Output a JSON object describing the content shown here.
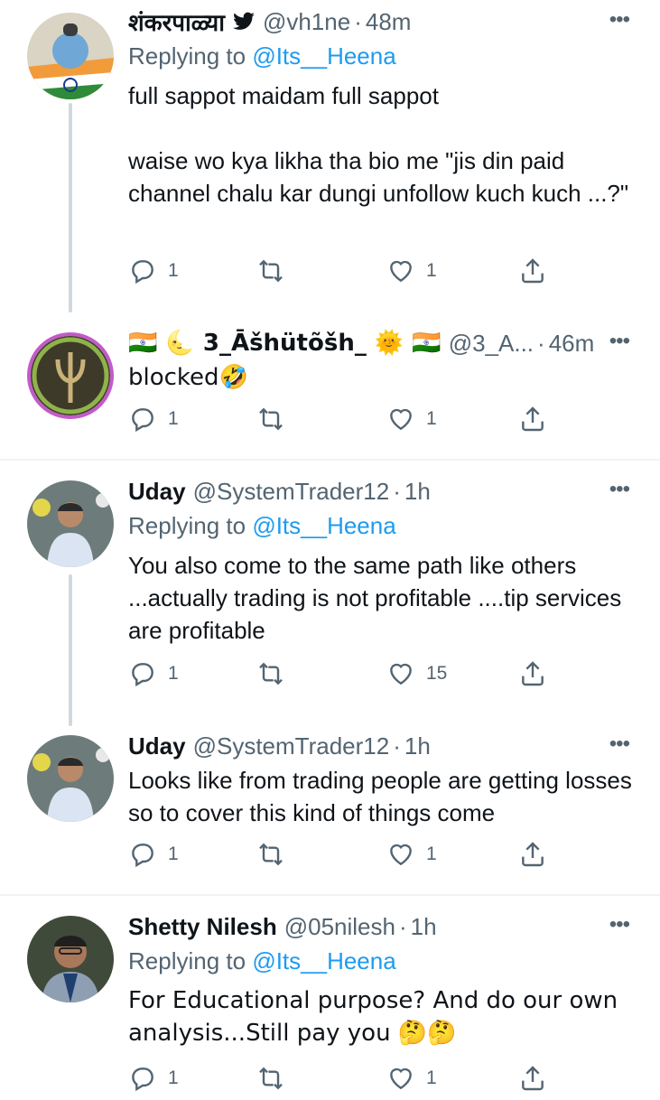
{
  "tweets": [
    {
      "name": "शंकरपाळ्या",
      "handle": "@vh1ne",
      "time": "48m",
      "replying_label": "Replying to",
      "replying_to": "@Its__Heena",
      "text": "full sappot maidam full sappot\n\nwaise wo kya likha tha bio me \"jis din paid channel chalu kar dungi unfollow kuch kuch ...?\"",
      "replies": "1",
      "likes": "1"
    },
    {
      "name": "🇮🇳 🌜 3_Āšhütõšh_ 🌞 🇮🇳",
      "handle": "@3_A...",
      "time": "46m",
      "text": "blocked🤣",
      "replies": "1",
      "likes": "1"
    },
    {
      "name": "Uday",
      "handle": "@SystemTrader12",
      "time": "1h",
      "replying_label": "Replying to",
      "replying_to": "@Its__Heena",
      "text": "You also come to the same path like others ...actually trading is not profitable ....tip services are profitable",
      "replies": "1",
      "likes": "15"
    },
    {
      "name": "Uday",
      "handle": "@SystemTrader12",
      "time": "1h",
      "text": "Looks like from trading people are getting losses so to cover this kind of things come",
      "replies": "1",
      "likes": "1"
    },
    {
      "name": "Shetty Nilesh",
      "handle": "@05nilesh",
      "time": "1h",
      "replying_label": "Replying to",
      "replying_to": "@Its__Heena",
      "text": "For Educational purpose? And do our own analysis...Still pay you 🤔🤔",
      "replies": "1",
      "likes": "1"
    }
  ],
  "ui": {
    "dot": "·",
    "more": "•••"
  },
  "colors": {
    "accent": "#1d9bf0",
    "muted": "#536471",
    "divider": "#eff3f4"
  }
}
